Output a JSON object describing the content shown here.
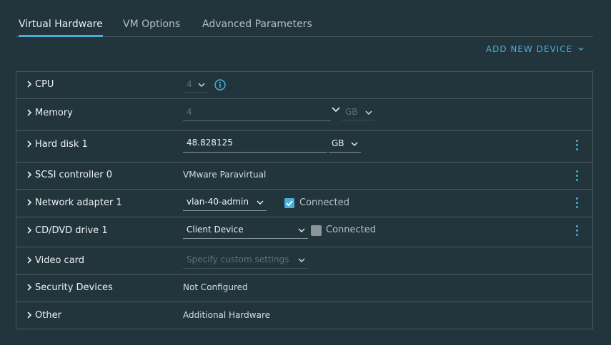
{
  "tabs": [
    {
      "label": "Virtual Hardware",
      "active": true
    },
    {
      "label": "VM Options",
      "active": false
    },
    {
      "label": "Advanced Parameters",
      "active": false
    }
  ],
  "add_device": {
    "label": "ADD NEW DEVICE"
  },
  "rows": {
    "cpu": {
      "label": "CPU",
      "value": "4"
    },
    "memory": {
      "label": "Memory",
      "value": "4",
      "unit": "GB"
    },
    "hard_disk": {
      "label": "Hard disk 1",
      "value": "48.828125",
      "unit": "GB"
    },
    "scsi": {
      "label": "SCSI controller 0",
      "value": "VMware Paravirtual"
    },
    "network": {
      "label": "Network adapter 1",
      "value": "vlan-40-admin",
      "connected_label": "Connected",
      "connected": true
    },
    "cdrom": {
      "label": "CD/DVD drive 1",
      "value": "Client Device",
      "connected_label": "Connected",
      "connected": false
    },
    "video": {
      "label": "Video card",
      "value": "Specify custom settings"
    },
    "security": {
      "label": "Security Devices",
      "value": "Not Configured"
    },
    "other": {
      "label": "Other",
      "value": "Additional Hardware"
    }
  },
  "colors": {
    "background": "#22343c",
    "accent": "#49afd9",
    "border": "#4a5a61"
  },
  "icons": {
    "caret": "chevron-right-icon",
    "info": "info-icon",
    "menu": "kebab-menu-icon",
    "dropdown": "chevron-down-icon"
  }
}
